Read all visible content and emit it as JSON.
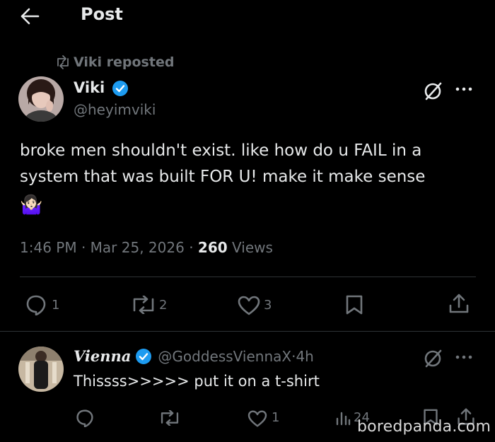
{
  "header": {
    "title": "Post"
  },
  "repost": {
    "label": "Viki reposted"
  },
  "post": {
    "author": {
      "name": "Viki",
      "handle": "@heyimviki"
    },
    "text": "broke men shouldn't exist. like how do u FAIL in a system that was built FOR U! make it make sense",
    "emoji": "🤷🏻‍♀️",
    "time": "1:46 PM",
    "date": "Mar 25, 2026",
    "views_count": "260",
    "views_label": "Views",
    "actions": {
      "replies": "1",
      "reposts": "2",
      "likes": "3"
    }
  },
  "reply": {
    "author": {
      "name": "Vienna",
      "handle": "@GoddessViennaX",
      "age": "4h"
    },
    "text": "Thissss>>>>> put it on a t-shirt",
    "actions": {
      "replies": "",
      "reposts": "",
      "likes": "1",
      "views": "24"
    }
  },
  "watermark": "boredpanda.com",
  "colors": {
    "background": "#000000",
    "text": "#e7e9ea",
    "muted": "#71767b",
    "verified": "#1d9bf0",
    "divider": "#2f3336"
  }
}
